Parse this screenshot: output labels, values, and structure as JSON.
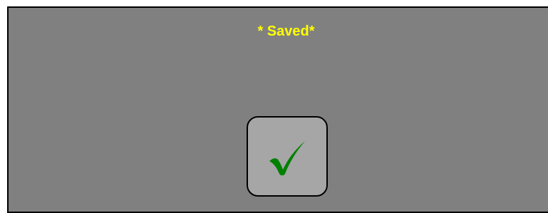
{
  "dialog": {
    "title": "* Saved*",
    "title_color": "#ffff00",
    "background_color": "#808080",
    "confirm_button": {
      "icon": "check-icon",
      "icon_color": "#008000",
      "background_color": "#a6a6a6"
    }
  }
}
